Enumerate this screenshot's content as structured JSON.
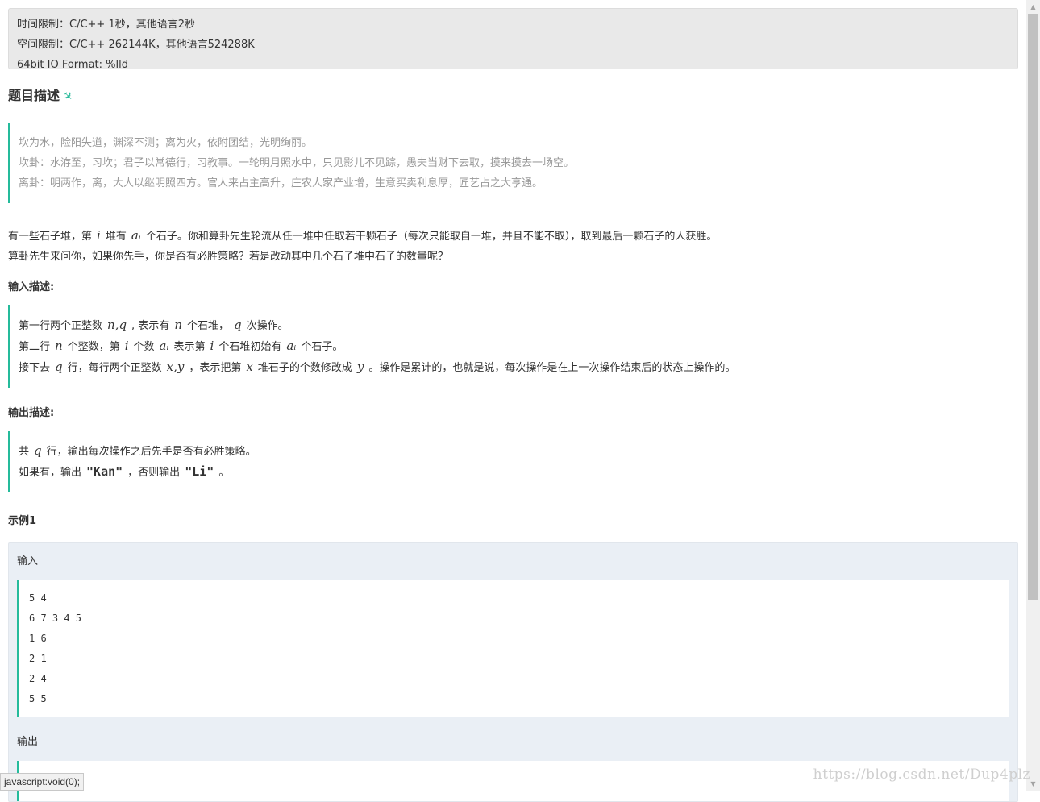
{
  "limits": {
    "time": "时间限制：C/C++ 1秒，其他语言2秒",
    "space": "空间限制：C/C++ 262144K，其他语言524288K",
    "io_format": "64bit IO Format: %lld"
  },
  "description": {
    "title": "题目描述",
    "poem": [
      "坎为水，险阳失道，渊深不测；离为火，依附团结，光明绚丽。",
      "坎卦：水洊至，习坎；君子以常德行，习教事。一轮明月照水中，只见影儿不见踪，愚夫当财下去取，摸来摸去一场空。",
      "离卦：明两作，离，大人以继明照四方。官人来占主高升，庄农人家产业增，生意买卖利息厚，匠艺占之大亨通。"
    ],
    "statement": {
      "p1_a": "有一些石子堆，第",
      "p1_var_i": "i",
      "p1_b": "堆有",
      "p1_var_ai": "aᵢ",
      "p1_c": "个石子。你和算卦先生轮流从任一堆中任取若干颗石子（每次只能取自一堆，并且不能不取），取到最后一颗石子的人获胜。",
      "p2": "算卦先生来问你，如果你先手，你是否有必胜策略？若是改动其中几个石子堆中石子的数量呢？"
    }
  },
  "input": {
    "title": "输入描述:",
    "l1_a": "第一行两个正整数",
    "l1_var": "n,q",
    "l1_b": ", 表示有",
    "l1_var_n": "n",
    "l1_c": "个石堆，",
    "l1_var_q": "q",
    "l1_d": "次操作。",
    "l2_a": "第二行",
    "l2_var_n": "n",
    "l2_b": "个整数，第",
    "l2_var_i": "i",
    "l2_c": "个数",
    "l2_var_ai": "aᵢ",
    "l2_d": "表示第",
    "l2_var_i2": "i",
    "l2_e": "个石堆初始有",
    "l2_var_ai2": "aᵢ",
    "l2_f": "个石子。",
    "l3_a": "接下去",
    "l3_var_q": "q",
    "l3_b": "行，每行两个正整数",
    "l3_var_xy": "x,y",
    "l3_c": "，表示把第",
    "l3_var_x": "x",
    "l3_d": "堆石子的个数修改成",
    "l3_var_y": "y",
    "l3_e": "。操作是累计的，也就是说，每次操作是在上一次操作结束后的状态上操作的。"
  },
  "output": {
    "title": "输出描述:",
    "l1_a": "共",
    "l1_var_q": "q",
    "l1_b": "行，输出每次操作之后先手是否有必胜策略。",
    "l2_a": "如果有，输出",
    "l2_kan": "\"Kan\"",
    "l2_b": "，否则输出",
    "l2_li": "\"Li\"",
    "l2_c": "。"
  },
  "example": {
    "title": "示例1",
    "input_label": "输入",
    "input_lines": [
      "5 4",
      "6 7 3 4 5",
      "1 6",
      "2 1",
      "2 4",
      "5 5"
    ],
    "output_label": "输出"
  },
  "status_bar": "javascript:void(0);",
  "watermark": "https://blog.csdn.net/Dup4plz"
}
